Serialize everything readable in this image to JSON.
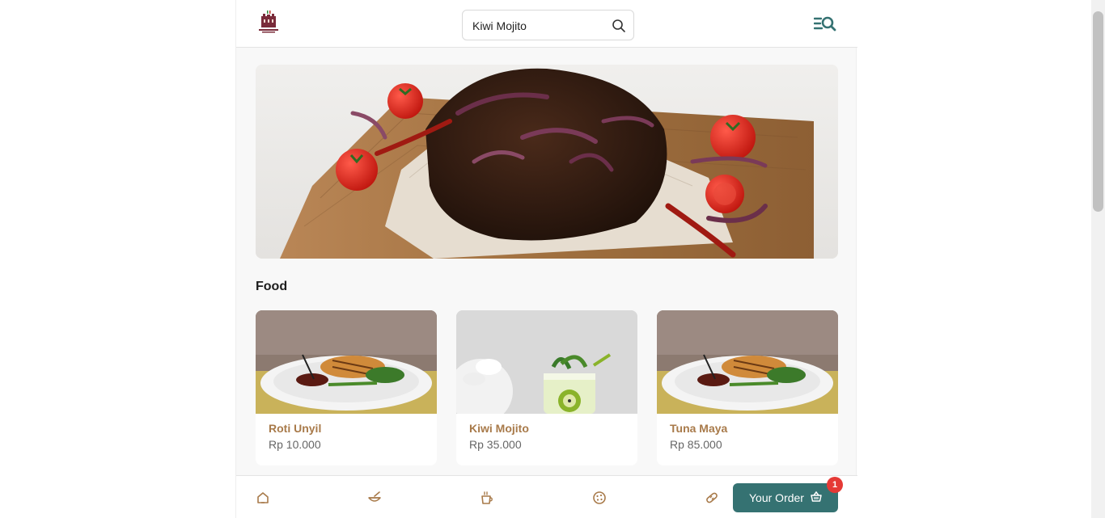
{
  "header": {
    "logo_alt": "SAN MARCO",
    "search": {
      "value": "Kiwi Mojito",
      "placeholder": "Search"
    }
  },
  "hero": {
    "image": "grilled-meat-with-tomatoes"
  },
  "section": {
    "title": "Food"
  },
  "cards": [
    {
      "name": "Roti Unyil",
      "price": "Rp 10.000",
      "image": "grilled-chicken-plate"
    },
    {
      "name": "Kiwi Mojito",
      "price": "Rp 35.000",
      "image": "kiwi-mojito-drink"
    },
    {
      "name": "Tuna Maya",
      "price": "Rp 85.000",
      "image": "grilled-chicken-plate"
    }
  ],
  "bottom_nav": {
    "icons": [
      "home-icon",
      "food-bowl-icon",
      "coffee-cup-icon",
      "cookie-icon",
      "bread-icon"
    ],
    "order_label": "Your Order",
    "order_count": "1"
  },
  "colors": {
    "accent": "#357272",
    "product_name": "#a87a4a",
    "nav_icon": "#a87a4a",
    "badge": "#e53935"
  }
}
